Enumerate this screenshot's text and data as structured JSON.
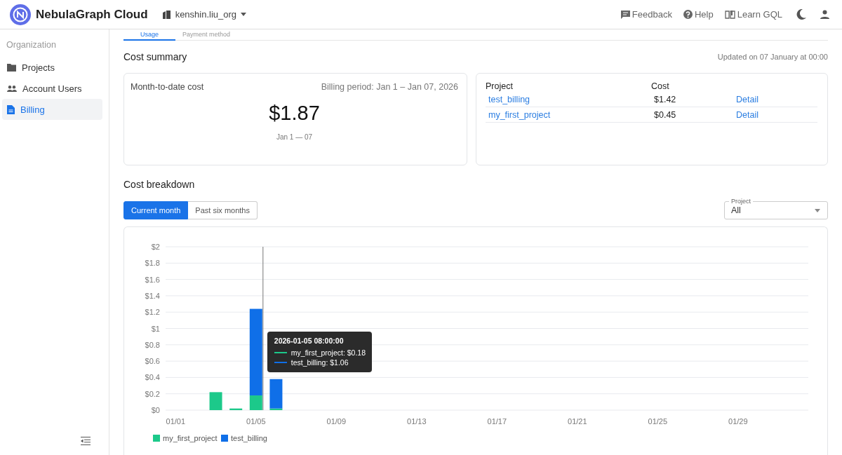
{
  "header": {
    "brand": "NebulaGraph Cloud",
    "org": "kenshin.liu_org",
    "links": [
      {
        "label": "Feedback"
      },
      {
        "label": "Help"
      },
      {
        "label": "Learn GQL"
      }
    ]
  },
  "sidebar": {
    "section": "Organization",
    "items": [
      {
        "label": "Projects",
        "selected": false
      },
      {
        "label": "Account Users",
        "selected": false
      },
      {
        "label": "Billing",
        "selected": true
      }
    ]
  },
  "tabs": [
    {
      "label": "Usage",
      "selected": true
    },
    {
      "label": "Payment method",
      "selected": false
    }
  ],
  "cost_summary": {
    "title": "Cost summary",
    "updated": "Updated on 07 January at 00:00",
    "label": "Month-to-date cost",
    "period": "Billing period: Jan 1 – Jan 07, 2026",
    "total": "$1.87",
    "range": "Jan 1 — 07"
  },
  "projects_table": {
    "columns": [
      "Project",
      "Cost"
    ],
    "rows": [
      {
        "project": "test_billing",
        "cost": "$1.42",
        "action": "Detail"
      },
      {
        "project": "my_first_project",
        "cost": "$0.45",
        "action": "Detail"
      }
    ]
  },
  "cost_breakdown": {
    "title": "Cost breakdown",
    "ranges": [
      {
        "label": "Current month",
        "selected": true
      },
      {
        "label": "Past six months",
        "selected": false
      }
    ],
    "filter": {
      "label": "Project",
      "value": "All"
    },
    "tooltip": {
      "title": "2026-01-05 08:00:00",
      "rows": [
        "my_first_project: $0.18",
        "test_billing: $1.06"
      ]
    },
    "chart_data": {
      "type": "bar",
      "stacked": true,
      "grid": true,
      "legend": true,
      "categories": [
        "01/01",
        null,
        null,
        null,
        "01/05",
        null,
        null,
        null,
        "01/09",
        null,
        null,
        null,
        "01/13",
        null,
        null,
        null,
        "01/17",
        null,
        null,
        null,
        "01/21",
        null,
        null,
        null,
        "01/25",
        null,
        null,
        null,
        "01/29",
        null,
        null,
        null
      ],
      "series": [
        {
          "name": "my_first_project",
          "color": "#1cc98a",
          "values": [
            0,
            0,
            0.22,
            0.02,
            0.18,
            0.02,
            0,
            null,
            null,
            null,
            null,
            null,
            null,
            null,
            null,
            null,
            null,
            null,
            null,
            null,
            null,
            null,
            null,
            null,
            null,
            null,
            null,
            null,
            null,
            null,
            null,
            null
          ]
        },
        {
          "name": "test_billing",
          "color": "#0f6fe8",
          "values": [
            0,
            0,
            0,
            0,
            1.06,
            0.36,
            0,
            null,
            null,
            null,
            null,
            null,
            null,
            null,
            null,
            null,
            null,
            null,
            null,
            null,
            null,
            null,
            null,
            null,
            null,
            null,
            null,
            null,
            null,
            null,
            null,
            null
          ]
        }
      ],
      "ylim": [
        0,
        2
      ],
      "yticks": [
        {
          "value": 0,
          "label": "$0"
        },
        {
          "value": 0.2,
          "label": "$0.2"
        },
        {
          "value": 0.4,
          "label": "$0.4"
        },
        {
          "value": 0.6,
          "label": "$0.6"
        },
        {
          "value": 0.8,
          "label": "$0.8"
        },
        {
          "value": 1,
          "label": "$1"
        },
        {
          "value": 1.2,
          "label": "$1.2"
        },
        {
          "value": 1.4,
          "label": "$1.4"
        },
        {
          "value": 1.6,
          "label": "$1.6"
        },
        {
          "value": 1.8,
          "label": "$1.8"
        },
        {
          "value": 2,
          "label": "$2"
        }
      ]
    }
  }
}
